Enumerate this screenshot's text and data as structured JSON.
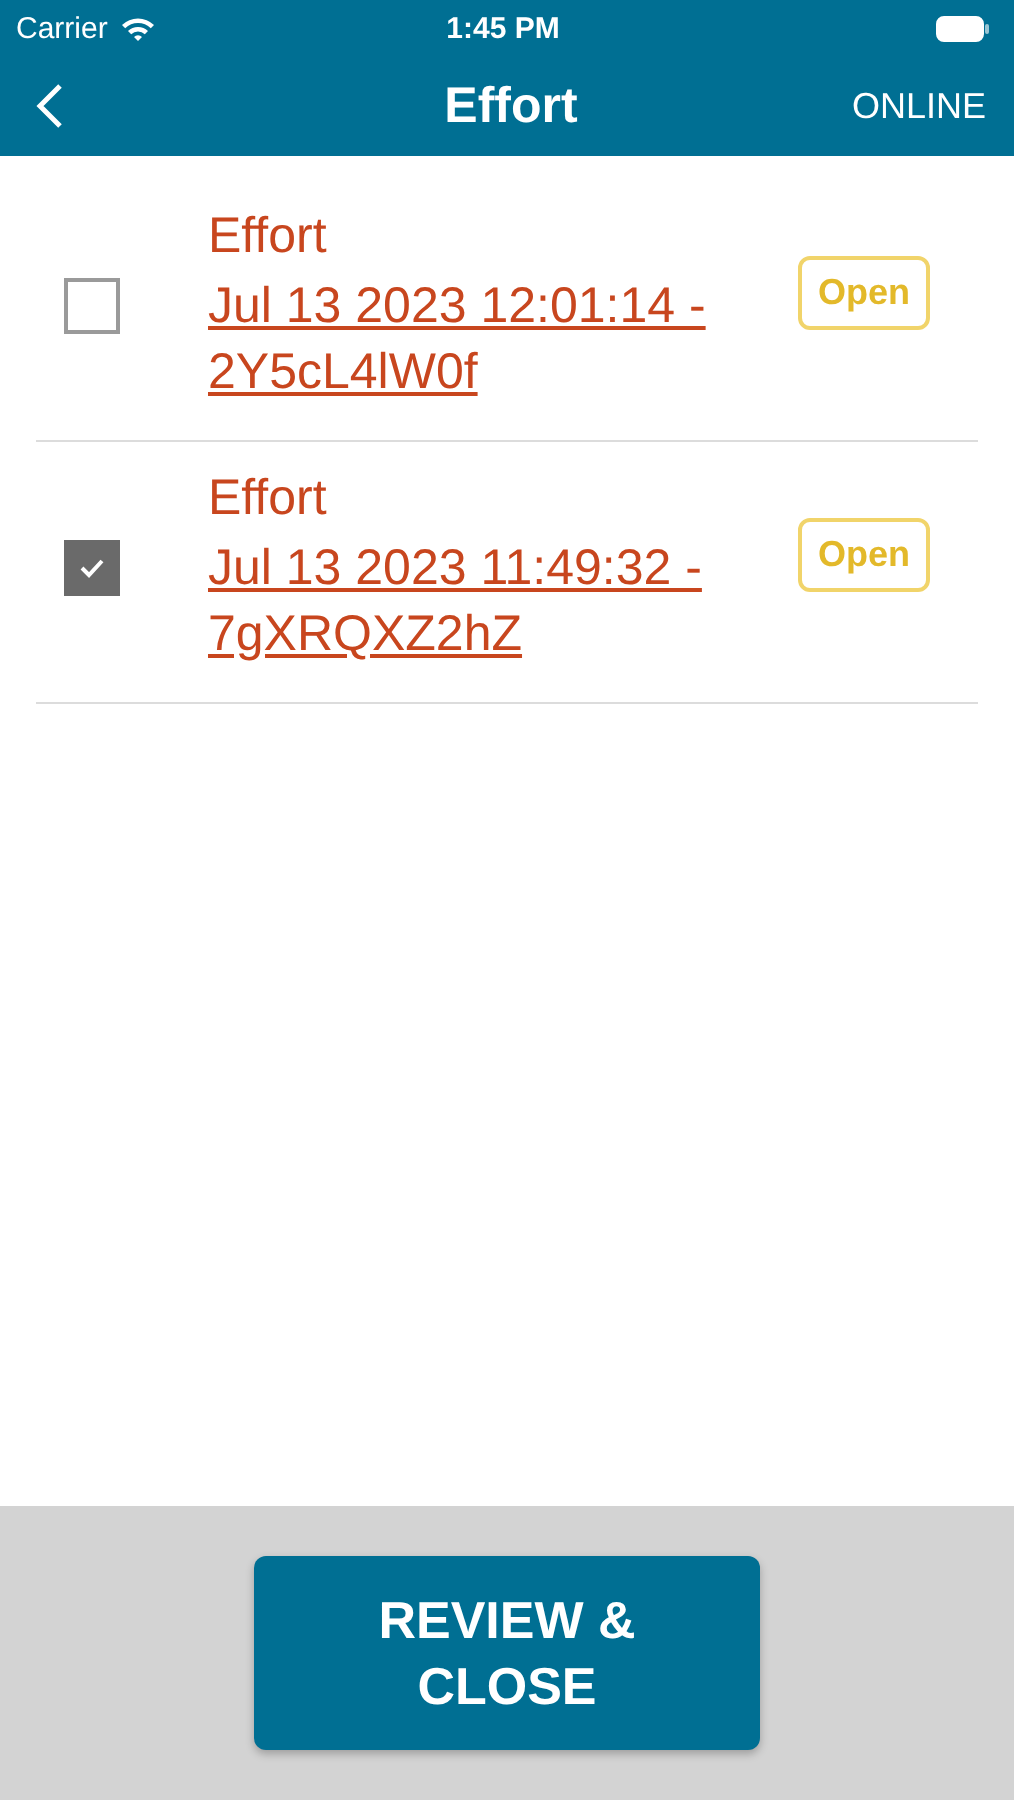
{
  "status_bar": {
    "carrier": "Carrier",
    "time": "1:45 PM"
  },
  "nav": {
    "title": "Effort",
    "status": "ONLINE"
  },
  "items": [
    {
      "title": "Effort",
      "link": "Jul 13 2023 12:01:14 - 2Y5cL4lW0f",
      "badge": "Open",
      "checked": false
    },
    {
      "title": "Effort",
      "link": "Jul 13 2023 11:49:32 - 7gXRQXZ2hZ",
      "badge": "Open",
      "checked": true
    }
  ],
  "footer": {
    "button": "REVIEW & CLOSE"
  }
}
